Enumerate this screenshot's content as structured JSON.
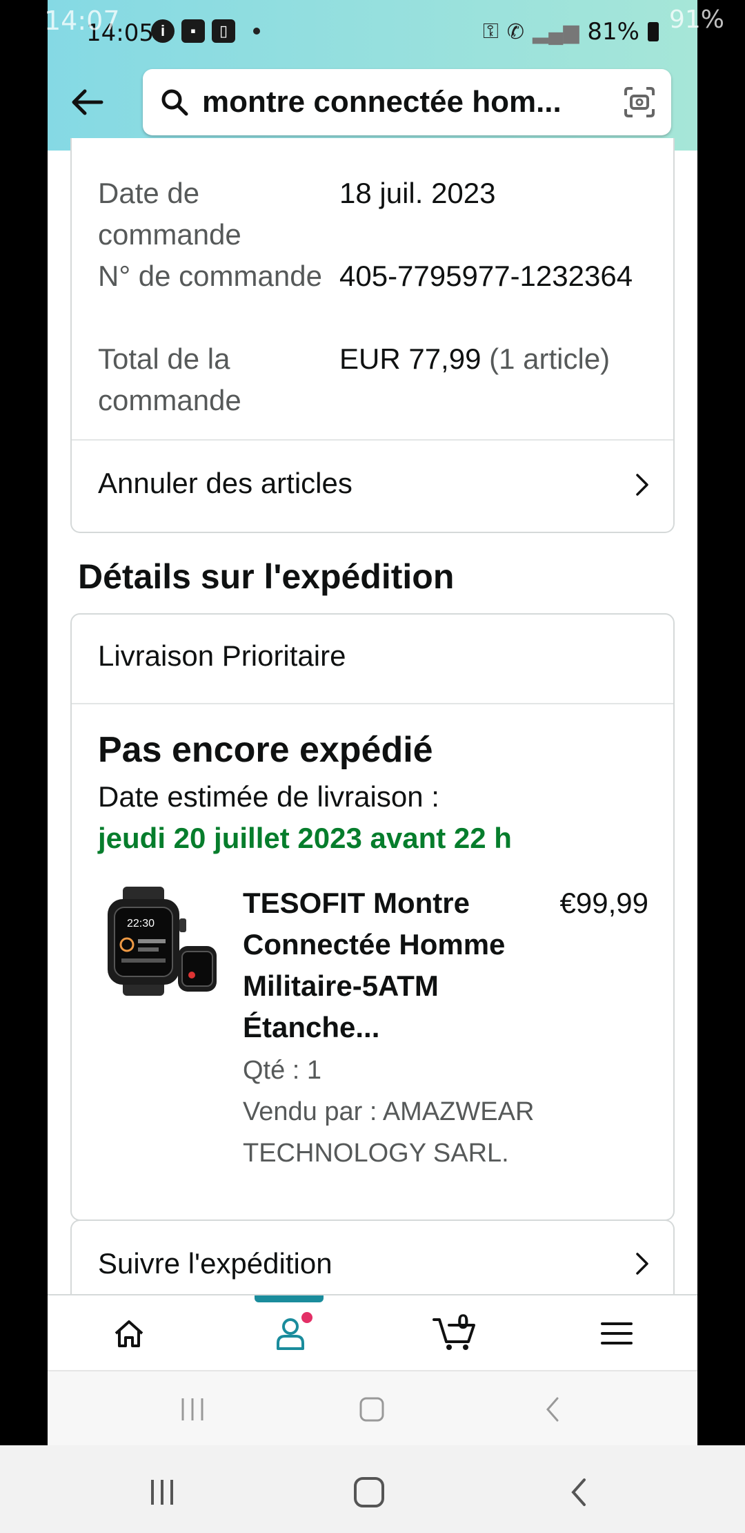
{
  "outer_status": {
    "time": "14:07",
    "battery": "91%"
  },
  "status_bar": {
    "time": "14:05",
    "battery": "81%"
  },
  "search": {
    "query": "montre connectée hom..."
  },
  "order": {
    "date_label": "Date de commande",
    "date_value": "18 juil. 2023",
    "number_label": "N° de commande",
    "number_value": "405-7795977-1232364",
    "total_label": "Total de la commande",
    "total_value": "EUR 77,99",
    "total_count": "(1 article)",
    "cancel_label": "Annuler des articles"
  },
  "shipment": {
    "section_title": "Détails sur l'expédition",
    "method": "Livraison Prioritaire",
    "status": "Pas encore expédié",
    "estimate_label": "Date estimée de livraison :",
    "estimate_date": "jeudi 20 juillet 2023 avant 22 h",
    "track_label": "Suivre l'expédition"
  },
  "product": {
    "title": "TESOFIT Montre Connectée Homme Militaire-5ATM Étanche...",
    "price": "€99,99",
    "quantity": "Qté : 1",
    "seller": "Vendu par : AMAZWEAR TECHNOLOGY SARL.",
    "image_icon": "smartwatch-image",
    "watch_time": "22:30"
  },
  "bottom_nav": {
    "items": [
      "home-icon",
      "account-icon",
      "cart-icon",
      "menu-icon"
    ],
    "cart_count": "0",
    "active": "account"
  },
  "colors": {
    "header_gradient_start": "#85d9e4",
    "header_gradient_end": "#a6e6d8",
    "delivery_green": "#067d2c",
    "active_teal": "#1a8c9c",
    "badge_pink": "#e32f66"
  }
}
